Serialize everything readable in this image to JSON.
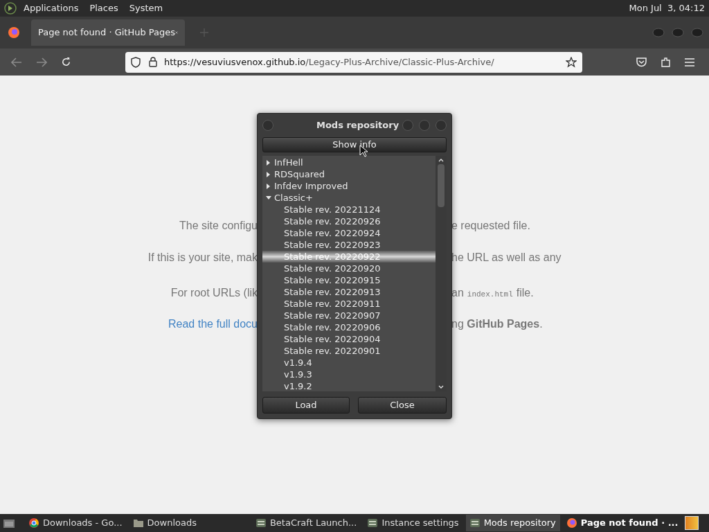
{
  "top_panel": {
    "menus": [
      "Applications",
      "Places",
      "System"
    ],
    "clock": "Mon Jul  3, 04:12"
  },
  "browser": {
    "tab": {
      "title": "Page not found · GitHub Pages",
      "selected": true
    },
    "url_host": "https://vesuviusvenox.github.io",
    "url_path": "/Legacy-Plus-Archive/Classic-Plus-Archive/"
  },
  "page": {
    "lines": [
      {
        "left": "The site configu",
        "right": "e requested file."
      },
      {
        "left": "If this is your site, mak",
        "right": "he URL as well as any"
      },
      {
        "left": "For root URLs (lik",
        "right": "an",
        "code": "index.html",
        "after": "file."
      },
      {
        "left": "Read the full docu",
        "right": "ng **GitHub Pages**.",
        "link": true
      }
    ]
  },
  "dialog": {
    "title": "Mods repository",
    "info_button": "Show info",
    "tree": [
      {
        "label": "InfHell",
        "expanded": false,
        "selected": false
      },
      {
        "label": "RDSquared",
        "expanded": false,
        "selected": false
      },
      {
        "label": "Infdev Improved",
        "expanded": false,
        "selected": false
      },
      {
        "label": "Classic+",
        "expanded": true,
        "selected": false,
        "children": [
          {
            "label": "Stable rev. 20221124",
            "selected": false
          },
          {
            "label": "Stable rev. 20220926",
            "selected": false
          },
          {
            "label": "Stable rev. 20220924",
            "selected": false
          },
          {
            "label": "Stable rev. 20220923",
            "selected": false
          },
          {
            "label": "Stable rev. 20220922",
            "selected": true
          },
          {
            "label": "Stable rev. 20220920",
            "selected": false
          },
          {
            "label": "Stable rev. 20220915",
            "selected": false
          },
          {
            "label": "Stable rev. 20220913",
            "selected": false
          },
          {
            "label": "Stable rev. 20220911",
            "selected": false
          },
          {
            "label": "Stable rev. 20220907",
            "selected": false
          },
          {
            "label": "Stable rev. 20220906",
            "selected": false
          },
          {
            "label": "Stable rev. 20220904",
            "selected": false
          },
          {
            "label": "Stable rev. 20220901",
            "selected": false
          },
          {
            "label": "v1.9.4",
            "selected": false
          },
          {
            "label": "v1.9.3",
            "selected": false
          },
          {
            "label": "v1.9.2",
            "selected": false
          }
        ]
      }
    ],
    "buttons": [
      "Load",
      "Close"
    ]
  },
  "taskbar": [
    {
      "kind": "chrome",
      "label": "Downloads - Go...",
      "selected": false
    },
    {
      "kind": "folder",
      "label": "Downloads",
      "selected": false
    },
    {
      "kind": "app",
      "label": "BetaCraft Launch...",
      "selected": false
    },
    {
      "kind": "app",
      "label": "Instance settings",
      "selected": false
    },
    {
      "kind": "app",
      "label": "Mods repository",
      "selected": true
    },
    {
      "kind": "firefox",
      "label": "Page not found · ...",
      "selected": false
    }
  ]
}
